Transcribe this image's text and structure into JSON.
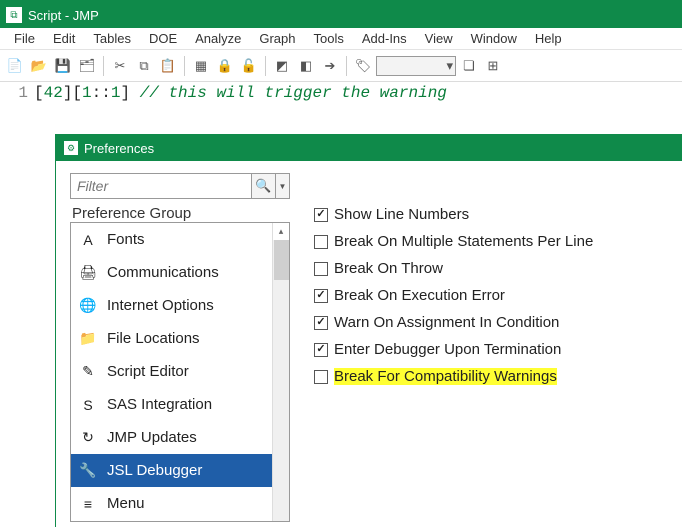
{
  "window": {
    "title": "Script - JMP"
  },
  "menubar": [
    "File",
    "Edit",
    "Tables",
    "DOE",
    "Analyze",
    "Graph",
    "Tools",
    "Add-Ins",
    "View",
    "Window",
    "Help"
  ],
  "code": {
    "line_no": "1",
    "punct1": "[",
    "n1": "42",
    "punct2": "][",
    "n2": "1",
    "colon1": "::",
    "n3": "1",
    "punct3": "] ",
    "comment": "// this will trigger the warning"
  },
  "preferences": {
    "title": "Preferences",
    "filter_placeholder": "Filter",
    "group_label": "Preference Group",
    "groups": [
      {
        "name": "Fonts",
        "icon": "A"
      },
      {
        "name": "Communications",
        "icon": "🖨"
      },
      {
        "name": "Internet Options",
        "icon": "🌐"
      },
      {
        "name": "File Locations",
        "icon": "📁"
      },
      {
        "name": "Script Editor",
        "icon": "✎"
      },
      {
        "name": "SAS Integration",
        "icon": "S"
      },
      {
        "name": "JMP Updates",
        "icon": "↻"
      },
      {
        "name": "JSL Debugger",
        "icon": "🔧"
      },
      {
        "name": "Menu",
        "icon": "≡"
      }
    ],
    "selected_index": 7,
    "options": [
      {
        "label": "Show Line Numbers",
        "checked": true,
        "highlight": false
      },
      {
        "label": "Break On Multiple Statements Per Line",
        "checked": false,
        "highlight": false
      },
      {
        "label": "Break On Throw",
        "checked": false,
        "highlight": false
      },
      {
        "label": "Break On Execution Error",
        "checked": true,
        "highlight": false
      },
      {
        "label": "Warn On Assignment In Condition",
        "checked": true,
        "highlight": false
      },
      {
        "label": "Enter Debugger Upon Termination",
        "checked": true,
        "highlight": false
      },
      {
        "label": "Break For Compatibility Warnings",
        "checked": false,
        "highlight": true
      }
    ]
  }
}
